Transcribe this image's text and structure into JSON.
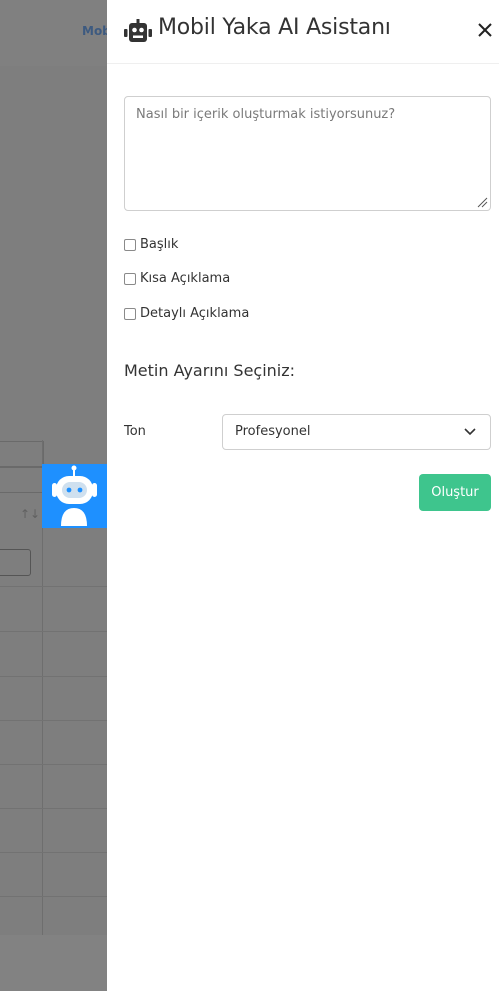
{
  "background": {
    "top_link_text": "Mob",
    "sort_icon": "sort-icon"
  },
  "fab": {
    "icon": "robot-icon",
    "color": "#1e90ff"
  },
  "panel": {
    "header_icon": "robot-icon",
    "title": "Mobil Yaka AI Asistanı",
    "close_icon": "close-icon"
  },
  "prompt": {
    "placeholder": "Nasıl bir içerik oluşturmak istiyorsunuz?",
    "value": ""
  },
  "options": [
    {
      "label": "Başlık",
      "checked": false
    },
    {
      "label": "Kısa Açıklama",
      "checked": false
    },
    {
      "label": "Detaylı Açıklama",
      "checked": false
    }
  ],
  "settings": {
    "section_title": "Metin Ayarını Seçiniz:",
    "tone_label": "Ton",
    "tone_value": "Profesyonel"
  },
  "submit": {
    "label": "Oluştur",
    "color": "#3ec58d"
  }
}
